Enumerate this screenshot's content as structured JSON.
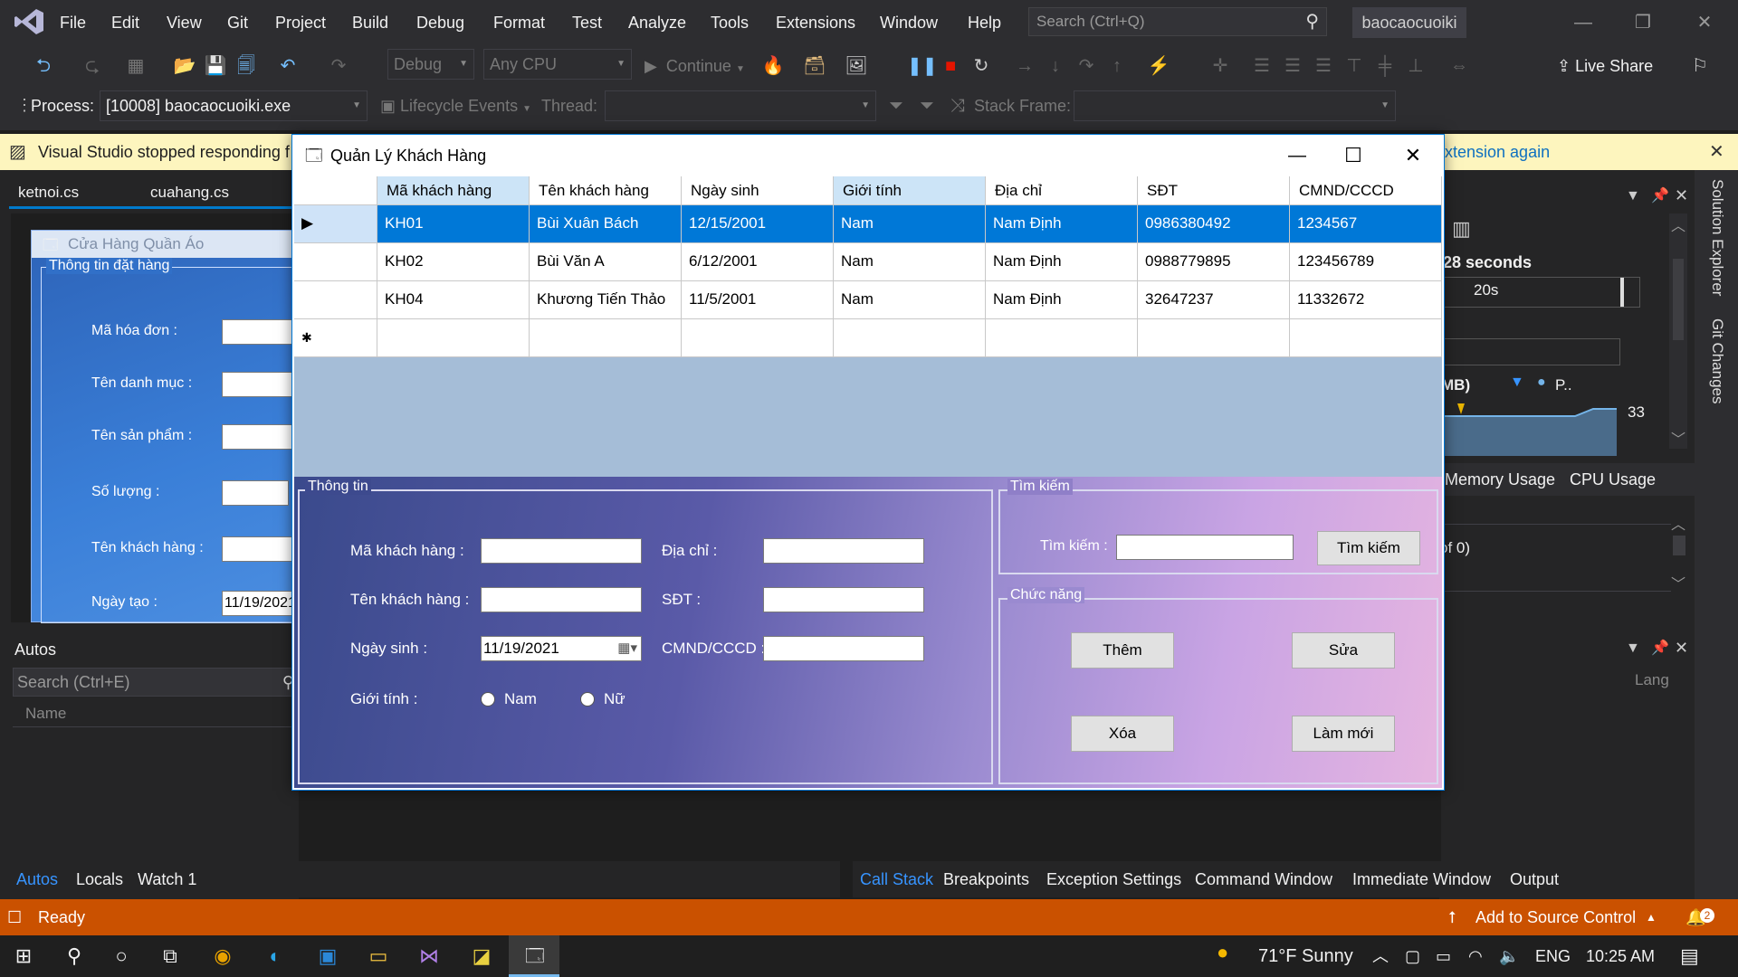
{
  "menubar": {
    "items": [
      "File",
      "Edit",
      "View",
      "Git",
      "Project",
      "Build",
      "Debug",
      "Format",
      "Test",
      "Analyze",
      "Tools",
      "Extensions",
      "Window",
      "Help"
    ],
    "search_placeholder": "Search (Ctrl+Q)",
    "solution_name": "baocaocuoiki"
  },
  "toolbar": {
    "config": "Debug",
    "platform": "Any CPU",
    "continue_label": "Continue",
    "live_share": "Live Share",
    "process_label": "Process:",
    "process_value": "[10008] baocaocuoiki.exe",
    "lifecycle": "Lifecycle Events",
    "thread_label": "Thread:",
    "stack_frame_label": "Stack Frame:"
  },
  "infobar": {
    "message": "Visual Studio stopped responding f",
    "link_tail": "xtension again"
  },
  "doc_tabs": [
    "ketnoi.cs",
    "cuahang.cs"
  ],
  "inner_form": {
    "title": "Cửa Hàng Quần Áo",
    "group": "Thông tin đặt hàng",
    "labels": [
      "Mã hóa đơn :",
      "Tên danh mục :",
      "Tên sản phẩm :",
      "Số lượng :",
      "Tên khách hàng :",
      "Ngày tạo :"
    ],
    "date_value": "11/19/2021"
  },
  "autos": {
    "title": "Autos",
    "search_placeholder": "Search (Ctrl+E)",
    "column": "Name",
    "tabs": [
      "Autos",
      "Locals",
      "Watch 1"
    ]
  },
  "diag": {
    "seconds": "28 seconds",
    "tick": "20s",
    "mb": "MB)",
    "p": "P..",
    "value": "33",
    "tabs": [
      "Memory Usage",
      "CPU Usage"
    ],
    "of": "of 0)",
    "lang": "Lang"
  },
  "side_tabs": [
    "Solution Explorer",
    "Git Changes"
  ],
  "bottom_right_tabs": [
    "Call Stack",
    "Breakpoints",
    "Exception Settings",
    "Command Window",
    "Immediate Window",
    "Output"
  ],
  "status": {
    "ready": "Ready",
    "source_control": "Add to Source Control",
    "notif_count": "2"
  },
  "taskbar": {
    "weather": "71°F  Sunny",
    "lang": "ENG",
    "time": "10:25 AM"
  },
  "dialog": {
    "title": "Quản Lý Khách Hàng",
    "columns": [
      "Mã khách hàng",
      "Tên khách hàng",
      "Ngày sinh",
      "Giới tính",
      "Địa chỉ",
      "SĐT",
      "CMND/CCCD"
    ],
    "rows": [
      [
        "KH01",
        "Bùi Xuân Bách",
        "12/15/2001",
        "Nam",
        "Nam Định",
        "0986380492",
        "1234567"
      ],
      [
        "KH02",
        "Bùi Văn A",
        "6/12/2001",
        "Nam",
        "Nam Định",
        "0988779895",
        "123456789"
      ],
      [
        "KH04",
        "Khương Tiến Thảo",
        "11/5/2001",
        "Nam",
        "Nam Định",
        "32647237",
        "11332672"
      ]
    ],
    "info_group": "Thông tin",
    "labels": {
      "ma": "Mã khách hàng :",
      "ten": "Tên khách hàng :",
      "ngaysinh": "Ngày sinh :",
      "gioitinh": "Giới tính :",
      "diachi": "Địa chỉ :",
      "sdt": "SĐT :",
      "cmnd": "CMND/CCCD :",
      "nam": "Nam",
      "nu": "Nữ"
    },
    "date_value": "11/19/2021",
    "search_group": "Tìm kiếm",
    "search_label": "Tìm kiếm :",
    "search_button": "Tìm kiếm",
    "func_group": "Chức năng",
    "buttons": {
      "them": "Thêm",
      "sua": "Sửa",
      "xoa": "Xóa",
      "lammoi": "Làm mới"
    }
  }
}
